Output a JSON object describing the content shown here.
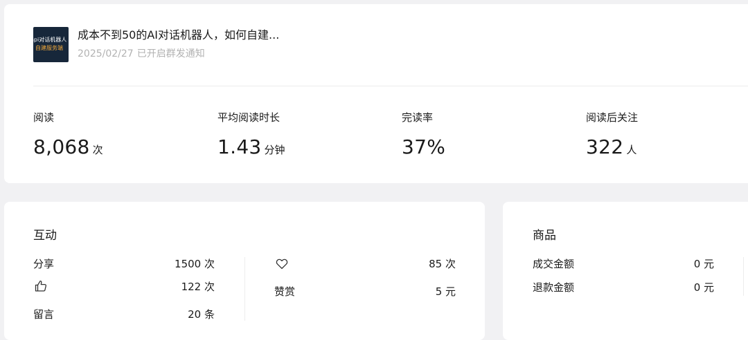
{
  "article": {
    "thumbnail_line1": "api对话机器人",
    "thumbnail_line2": "自建服务端",
    "title": "成本不到50的AI对话机器人，如何自建...",
    "date": "2025/02/27",
    "notify_status": "已开启群发通知"
  },
  "stats": [
    {
      "label": "阅读",
      "value": "8,068",
      "unit": "次"
    },
    {
      "label": "平均阅读时长",
      "value": "1.43",
      "unit": "分钟"
    },
    {
      "label": "完读率",
      "value": "37%",
      "unit": ""
    },
    {
      "label": "阅读后关注",
      "value": "322",
      "unit": "人"
    }
  ],
  "interaction": {
    "title": "互动",
    "left": [
      {
        "label": "分享",
        "icon": "",
        "value": "1500 次"
      },
      {
        "label": "",
        "icon": "thumbs-up-icon",
        "value": "122 次"
      },
      {
        "label": "留言",
        "icon": "",
        "value": "20 条"
      }
    ],
    "right": [
      {
        "label": "",
        "icon": "heart-icon",
        "value": "85 次"
      },
      {
        "label": "赞赏",
        "icon": "",
        "value": "5 元"
      }
    ]
  },
  "goods": {
    "title": "商品",
    "rows": [
      {
        "label": "成交金额",
        "value": "0 元"
      },
      {
        "label": "退款金额",
        "value": "0 元"
      }
    ]
  }
}
